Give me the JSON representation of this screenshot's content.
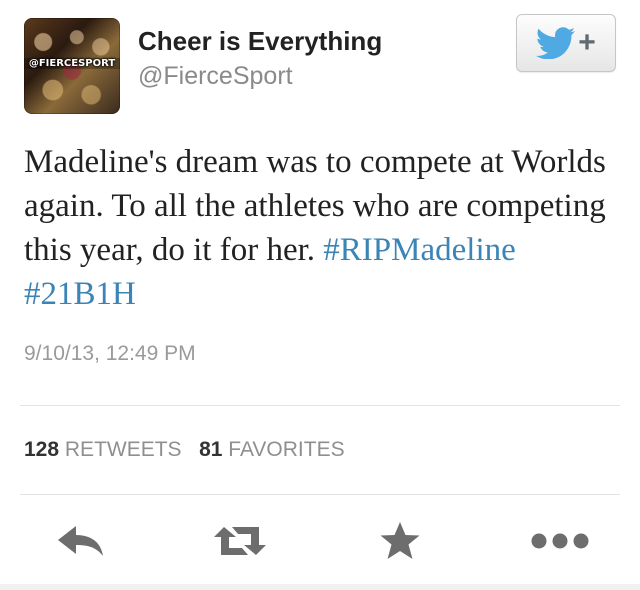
{
  "profile": {
    "display_name": "Cheer is Everything",
    "handle": "@FierceSport",
    "avatar_text": "@FIERCESPORT"
  },
  "follow_button": {
    "icon": "twitter-bird-icon",
    "label": "+"
  },
  "tweet": {
    "text": "Madeline's dream was to compete at Worlds again. To all the athletes who are competing this year, do it for her.",
    "hashtags": [
      "#RIPMadeline",
      "#21B1H"
    ],
    "timestamp": "9/10/13, 12:49 PM"
  },
  "stats": {
    "retweets_count": "128",
    "retweets_label": "RETWEETS",
    "favorites_count": "81",
    "favorites_label": "FAVORITES"
  },
  "actions": [
    {
      "name": "reply",
      "icon": "reply-icon"
    },
    {
      "name": "retweet",
      "icon": "retweet-icon"
    },
    {
      "name": "favorite",
      "icon": "star-icon"
    },
    {
      "name": "more",
      "icon": "more-icon"
    }
  ],
  "colors": {
    "hashtag": "#3a84b6",
    "twitter_blue": "#4fa9e3",
    "icon_gray": "#6d6d6d"
  }
}
